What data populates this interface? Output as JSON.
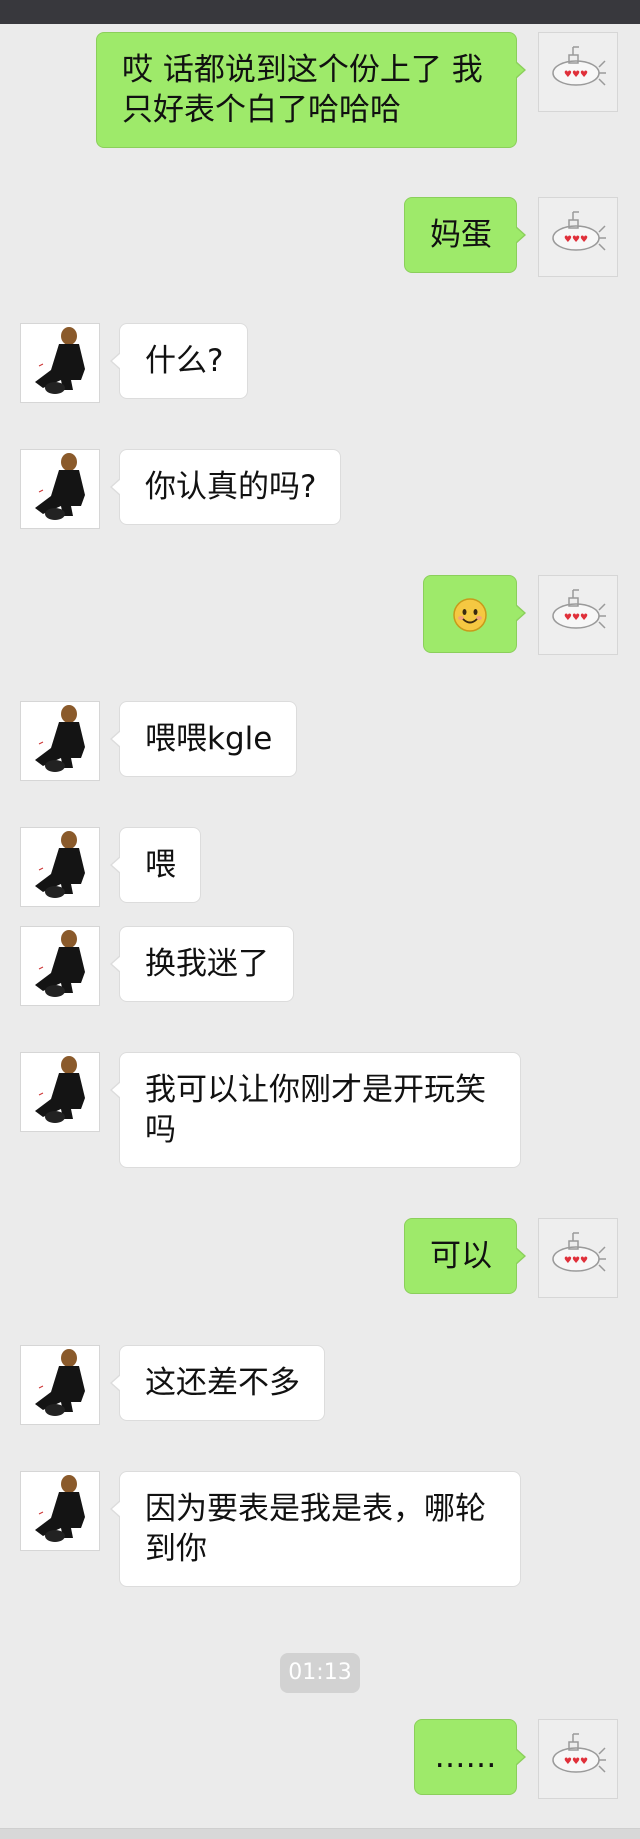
{
  "colors": {
    "background": "#ebebeb",
    "sent_bubble": "#9eea6a",
    "received_bubble": "#ffffff",
    "timestamp_bg": "#d2d2d2"
  },
  "messages": [
    {
      "side": "right",
      "text": "哎 话都说到这个份上了 我只好表个白了哈哈哈"
    },
    {
      "side": "right",
      "text": "妈蛋"
    },
    {
      "side": "left",
      "text": "什么?"
    },
    {
      "side": "left",
      "text": "你认真的吗?"
    },
    {
      "side": "right",
      "icon": "smiley-emoji-icon"
    },
    {
      "side": "left",
      "text": "喂喂kgle"
    },
    {
      "side": "left",
      "text": "喂"
    },
    {
      "side": "left",
      "text": "换我迷了"
    },
    {
      "side": "left",
      "text": "我可以让你刚才是开玩笑吗"
    },
    {
      "side": "right",
      "text": "可以"
    },
    {
      "side": "left",
      "text": "这还差不多"
    },
    {
      "side": "left",
      "text": "因为要表是我是表，哪轮到你"
    },
    {
      "side": "right",
      "text": "……"
    }
  ],
  "timestamp": "01:13",
  "avatars": {
    "self": "submarine-hearts-icon",
    "contact": "person-dark-outfit-avatar"
  }
}
